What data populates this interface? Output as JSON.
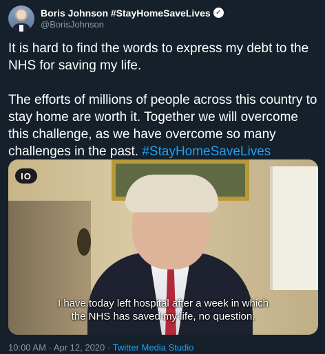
{
  "user": {
    "display_name": "Boris Johnson #StayHomeSaveLives",
    "handle": "@BorisJohnson",
    "verified_icon": "verified-check-icon"
  },
  "tweet": {
    "paragraph1": "It is hard to find the words to express my debt to the NHS for saving my life.",
    "paragraph2": "The efforts of millions of people across this country to stay home are worth it. Together we will overcome this challenge, as we have overcome so many challenges in the past.",
    "hashtag": "#StayHomeSaveLives"
  },
  "media": {
    "logo_text": "IO",
    "caption_line1": "I have today left hospital after a week in which",
    "caption_line2": "the NHS has saved my life, no question."
  },
  "meta": {
    "time": "10:00 AM",
    "date": "Apr 12, 2020",
    "separator": "·",
    "source": "Twitter Media Studio"
  },
  "colors": {
    "background": "#15202b",
    "link": "#1da1f2",
    "muted": "#8899a6"
  }
}
